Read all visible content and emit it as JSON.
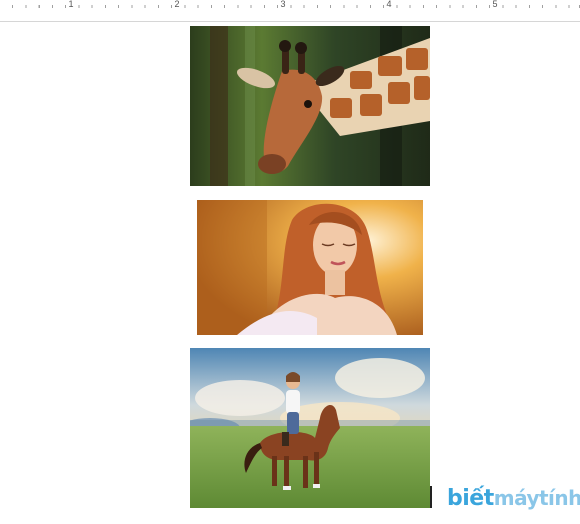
{
  "ruler": {
    "numbers": [
      "1",
      "2",
      "3",
      "4",
      "5"
    ]
  },
  "images": [
    {
      "subject": "giraffe",
      "colors": {
        "bg": "#3f5a2a",
        "accent": "#b8692c"
      }
    },
    {
      "subject": "woman-portrait",
      "colors": {
        "bg": "#d88a2a",
        "accent": "#f3d5b8"
      }
    },
    {
      "subject": "rider-on-horse",
      "colors": {
        "sky": "#7fa6c9",
        "grass": "#7ea84a",
        "horse": "#7a3a1c"
      }
    }
  ],
  "watermark": {
    "logo_part1": "biết",
    "logo_part2": "máytính",
    "colors": {
      "primary": "#3aa5dc",
      "secondary": "#8ac6e8"
    }
  }
}
